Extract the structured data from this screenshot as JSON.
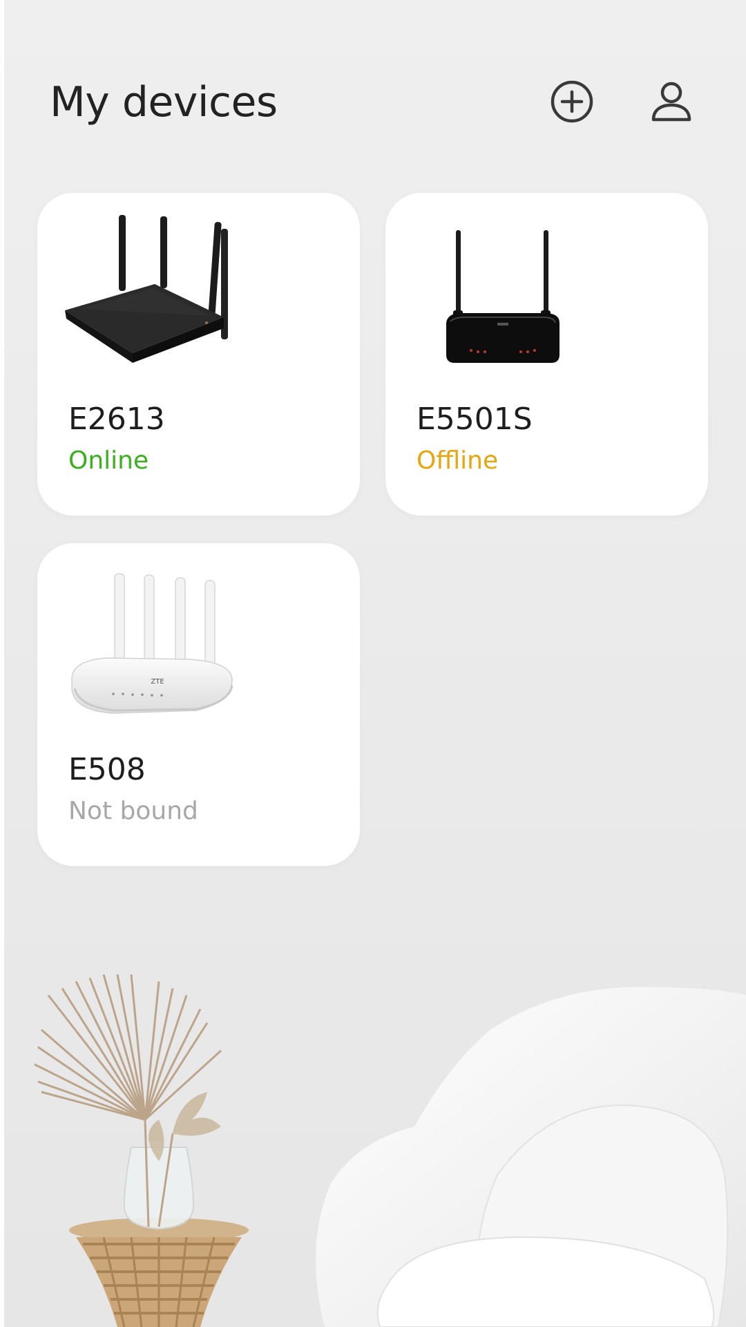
{
  "header": {
    "title": "My devices",
    "add_icon": "plus-circle-icon",
    "user_icon": "user-icon"
  },
  "colors": {
    "online": "#3ab01c",
    "offline": "#e8a50c",
    "not_bound": "#a7a7a7"
  },
  "devices": [
    {
      "name": "E2613",
      "status": "Online",
      "status_color": "#3ab01c",
      "image": "black-router-four-antennas"
    },
    {
      "name": "E5501S",
      "status": "Offline",
      "status_color": "#e8a50c",
      "image": "black-router-two-antennas"
    },
    {
      "name": "E508",
      "status": "Not bound",
      "status_color": "#a7a7a7",
      "image": "white-router-four-antennas"
    }
  ]
}
